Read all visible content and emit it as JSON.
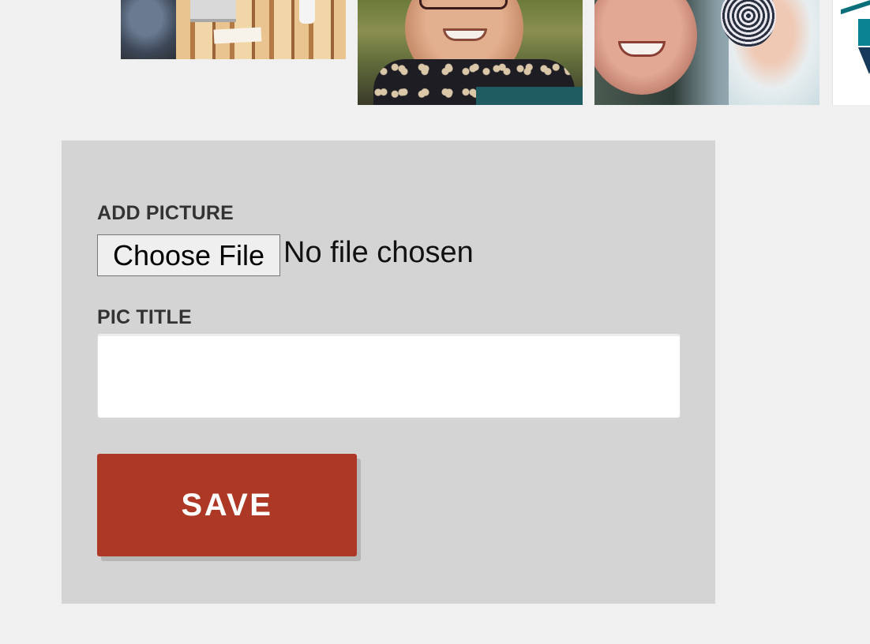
{
  "gallery": {
    "photos": [
      {
        "name": "photo-laptop-table"
      },
      {
        "name": "photo-woman-glasses-scarf"
      },
      {
        "name": "photo-woman-with-baby"
      },
      {
        "name": "photo-logo"
      }
    ]
  },
  "form": {
    "add_picture_label": "ADD PICTURE",
    "choose_file_label": "Choose File",
    "file_status": "No file chosen",
    "pic_title_label": "PIC TITLE",
    "pic_title_value": "",
    "save_label": "SAVE"
  },
  "colors": {
    "page_bg": "#f0f0f0",
    "panel_bg": "#d4d4d4",
    "save_button": "#ad3825",
    "label_text": "#333333"
  }
}
